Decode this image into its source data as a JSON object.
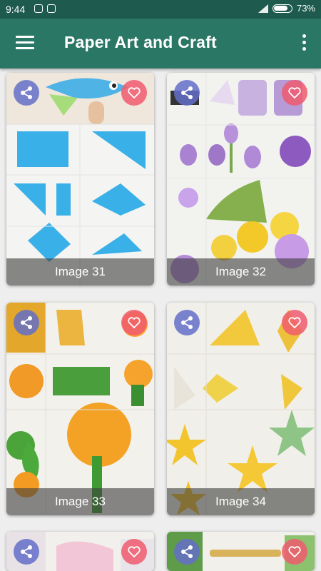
{
  "status_bar": {
    "time": "9:44",
    "battery": "73%"
  },
  "app_bar": {
    "title": "Paper Art and Craft",
    "menu_icon": "menu-icon",
    "overflow_icon": "more-vert-icon"
  },
  "colors": {
    "status_bar": "#1e5a4e",
    "app_bar": "#2b7766",
    "share": "#6470c8",
    "favorite": "#f05a6e"
  },
  "cards": [
    {
      "label": "Image 31"
    },
    {
      "label": "Image 32"
    },
    {
      "label": "Image 33"
    },
    {
      "label": "Image 34"
    },
    {
      "label": ""
    },
    {
      "label": ""
    }
  ]
}
